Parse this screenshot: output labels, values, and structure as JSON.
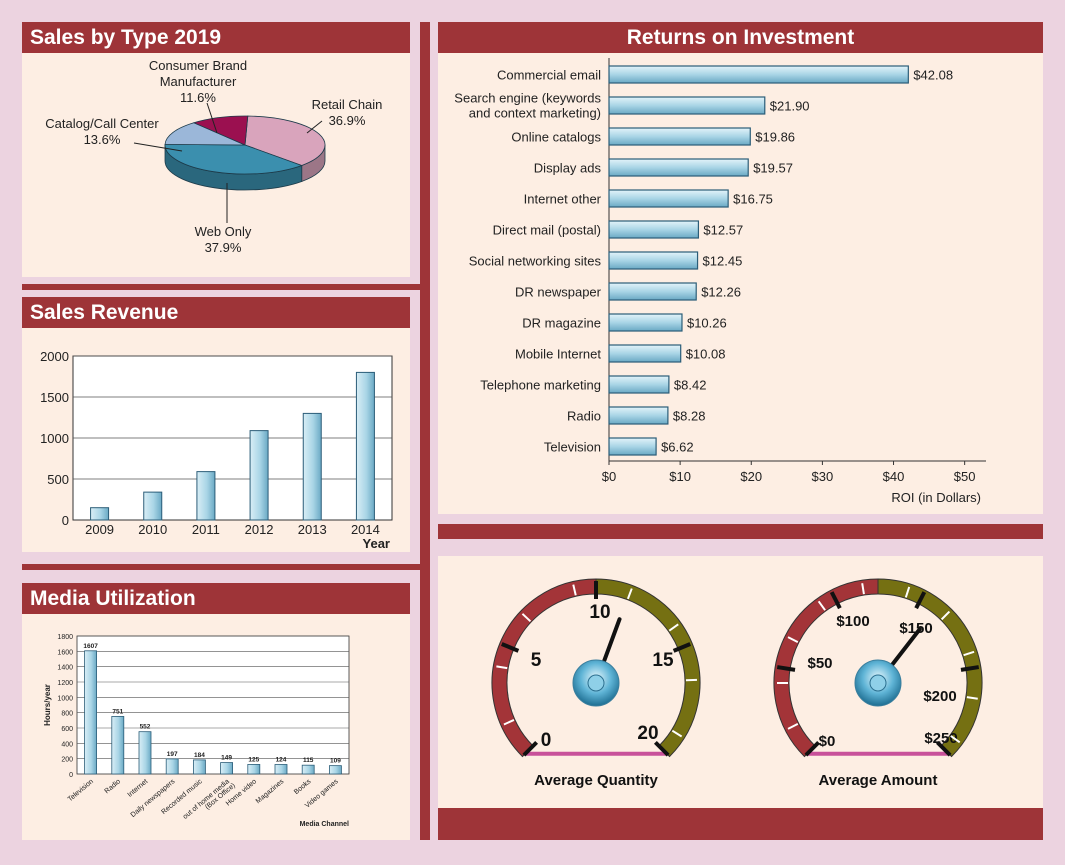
{
  "colors": {
    "header": "#9e3438",
    "panel": "#fdeee3",
    "page": "#ecd3e0",
    "bar_fill": "#a9d5e6",
    "bar_edge": "#2b5d78"
  },
  "panels": {
    "pie_title": "Sales by Type 2019",
    "revenue_title": "Sales Revenue",
    "media_title": "Media Utilization",
    "roi_title": "Returns on Investment"
  },
  "chart_data": [
    {
      "type": "pie",
      "title": "Sales by Type 2019",
      "slices": [
        {
          "label": "Retail Chain",
          "value": 36.9,
          "value_text": "36.9%",
          "color": "#d9a4bc"
        },
        {
          "label": "Web Only",
          "value": 37.9,
          "value_text": "37.9%",
          "color": "#3b8fae"
        },
        {
          "label": "Catalog/Call Center",
          "value": 13.6,
          "value_text": "13.6%",
          "color": "#9bb7d9"
        },
        {
          "label": "Consumer Brand Manufacturer",
          "value": 11.6,
          "value_text": "11.6%",
          "color": "#9b1050"
        }
      ]
    },
    {
      "type": "bar",
      "title": "Sales Revenue",
      "categories": [
        "2009",
        "2010",
        "2011",
        "2012",
        "2013",
        "2014"
      ],
      "values": [
        150,
        340,
        590,
        1090,
        1300,
        1800
      ],
      "xlabel": "Year",
      "ylim": [
        0,
        2000
      ],
      "yticks": [
        "0",
        "500",
        "1000",
        "1500",
        "2000"
      ]
    },
    {
      "type": "bar",
      "title": "Media Utilization",
      "categories": [
        "Television",
        "Radio",
        "Internet",
        "Daily newspapers",
        "Recorded music",
        "out of home media (Box Office)",
        "Home video",
        "Magazines",
        "Books",
        "Video games"
      ],
      "values": [
        1607,
        751,
        552,
        197,
        184,
        149,
        125,
        124,
        115,
        109
      ],
      "value_labels": [
        "1607",
        "751",
        "552",
        "197",
        "184",
        "149",
        "125",
        "124",
        "115",
        "109"
      ],
      "xlabel": "Media Channel",
      "ylabel": "Hours/year",
      "ylim": [
        0,
        1800
      ],
      "yticks": [
        "0",
        "200",
        "400",
        "600",
        "800",
        "1000",
        "1200",
        "1400",
        "1600",
        "1800"
      ]
    },
    {
      "type": "bar",
      "orientation": "horizontal",
      "title": "Returns on Investment",
      "categories": [
        "Commercial email",
        "Search engine (keywords|and context marketing)",
        "Online catalogs",
        "Display ads",
        "Internet other",
        "Direct mail (postal)",
        "Social networking sites",
        "DR newspaper",
        "DR magazine",
        "Mobile Internet",
        "Telephone marketing",
        "Radio",
        "Television"
      ],
      "values": [
        42.08,
        21.9,
        19.86,
        19.57,
        16.75,
        12.57,
        12.45,
        12.26,
        10.26,
        10.08,
        8.42,
        8.28,
        6.62
      ],
      "value_labels": [
        "$42.08",
        "$21.90",
        "$19.86",
        "$19.57",
        "$16.75",
        "$12.57",
        "$12.45",
        "$12.26",
        "$10.26",
        "$10.08",
        "$8.42",
        "$8.28",
        "$6.62"
      ],
      "xlabel": "ROI (in Dollars)",
      "xlim": [
        0,
        53
      ],
      "xticks": [
        "$0",
        "$10",
        "$20",
        "$30",
        "$40",
        "$50"
      ]
    },
    {
      "type": "gauge",
      "title": "Average Quantity",
      "ticks": [
        "0",
        "5",
        "10",
        "15",
        "20"
      ],
      "range": [
        0,
        20
      ],
      "value": 11.5
    },
    {
      "type": "gauge",
      "title": "Average Amount",
      "ticks": [
        "$0",
        "$50",
        "$100",
        "$150",
        "$200",
        "$250"
      ],
      "range": [
        0,
        250
      ],
      "value": 160
    }
  ]
}
